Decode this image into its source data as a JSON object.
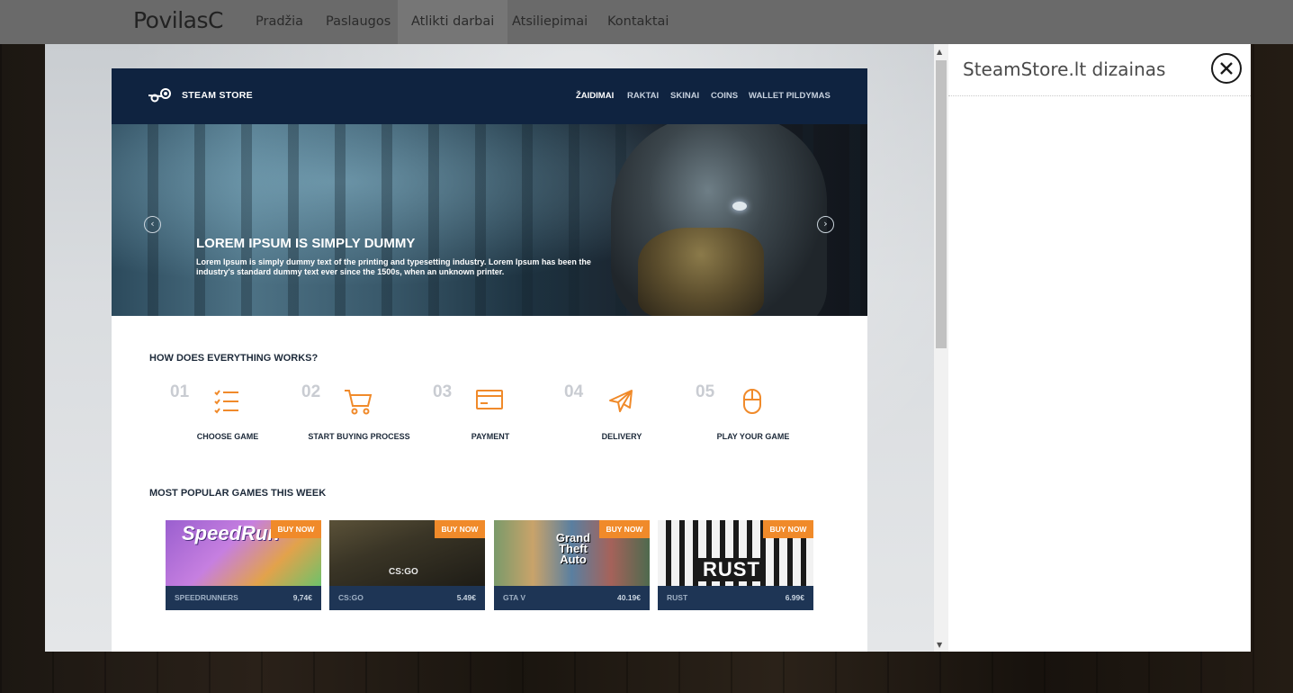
{
  "nav": {
    "brand": "PovilasC",
    "items": [
      {
        "label": "Pradžia"
      },
      {
        "label": "Paslaugos"
      },
      {
        "label": "Atlikti darbai"
      },
      {
        "label": "Atsiliepimai"
      },
      {
        "label": "Kontaktai"
      }
    ],
    "active_index": 2
  },
  "modal": {
    "title": "SteamStore.lt dizainas",
    "close_icon": "close-circle-icon",
    "scroll_up_icon": "▲",
    "scroll_down_icon": "▼"
  },
  "site": {
    "logo_text": "STEAM STORE",
    "menu": [
      "ŽAIDIMAI",
      "RAKTAI",
      "SKINAI",
      "COINS",
      "WALLET PILDYMAS"
    ],
    "hero": {
      "title": "LOREM IPSUM IS SIMPLY DUMMY",
      "text": "Lorem Ipsum is simply dummy text of the printing and typesetting industry. Lorem Ipsum has been the industry's standard dummy text ever since the 1500s, when an unknown printer.",
      "prev_arrow": "‹",
      "next_arrow": "›"
    },
    "how_title": "HOW DOES EVERYTHING WORKS?",
    "steps": [
      {
        "num": "01",
        "label": "CHOOSE GAME",
        "icon": "checklist-icon"
      },
      {
        "num": "02",
        "label": "START BUYING PROCESS",
        "icon": "cart-icon"
      },
      {
        "num": "03",
        "label": "PAYMENT",
        "icon": "credit-card-icon"
      },
      {
        "num": "04",
        "label": "DELIVERY",
        "icon": "plane-icon"
      },
      {
        "num": "05",
        "label": "PLAY YOUR GAME",
        "icon": "mouse-icon"
      }
    ],
    "popular_title": "MOST POPULAR GAMES THIS WEEK",
    "games": [
      {
        "name": "SPEEDRUNNERS",
        "price": "9,74€",
        "buy": "BUY NOW",
        "logo": "SpeedRun"
      },
      {
        "name": "CS:GO",
        "price": "5.49€",
        "buy": "BUY NOW",
        "logo": "CS:GO"
      },
      {
        "name": "GTA V",
        "price": "40.19€",
        "buy": "BUY NOW",
        "logo": "Grand Theft Auto"
      },
      {
        "name": "RUST",
        "price": "6.99€",
        "buy": "BUY NOW",
        "logo": "RUST"
      }
    ],
    "colors": {
      "header": "#0f2340",
      "accent": "#f08a2a"
    }
  }
}
